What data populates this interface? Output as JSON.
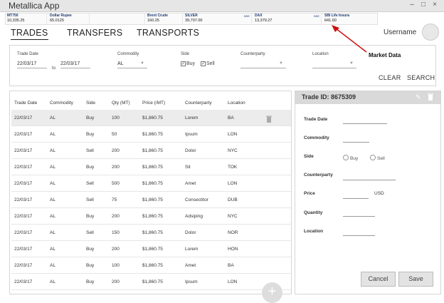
{
  "window": {
    "title": "Metallica App",
    "controls": [
      "–",
      "□",
      "×"
    ]
  },
  "ticker": [
    {
      "name": "MT750",
      "value": "10,335.25"
    },
    {
      "name": "Dollar Rupee",
      "value": "65.0125"
    },
    {
      "name": "",
      "value": ""
    },
    {
      "name": "Brent Crude",
      "value": "160.25"
    },
    {
      "name": "SILVER",
      "value": "39,707.00",
      "sub": "NSE"
    },
    {
      "name": "DAX",
      "value": "13,379.27",
      "sub": "NSE"
    },
    {
      "name": "SBI Life Insura",
      "value": "641.60",
      "sub": "NSE"
    }
  ],
  "tabs": [
    "TRADES",
    "TRANSFERS",
    "TRANSPORTS"
  ],
  "user": {
    "name": "Username"
  },
  "filters": {
    "trade_date_label": "Trade Date",
    "date_from": "22/03/17",
    "to_label": "to",
    "date_to": "22/03/17",
    "commodity_label": "Commodity",
    "commodity_value": "AL",
    "side_label": "Side",
    "buy_label": "Buy",
    "sell_label": "Sell",
    "counterparty_label": "Counterparty",
    "location_label": "Location",
    "clear_label": "CLEAR",
    "search_label": "SEARCH"
  },
  "table": {
    "columns": [
      "Trade Date",
      "Commodity",
      "Side",
      "Qty (MT)",
      "Price (/MT)",
      "Counterparty",
      "Location"
    ],
    "rows": [
      [
        "22/03/17",
        "AL",
        "Buy",
        "100",
        "$1,860.75",
        "Lorem",
        "BA"
      ],
      [
        "22/03/17",
        "AL",
        "Buy",
        "50",
        "$1,860.75",
        "Ipsum",
        "LON"
      ],
      [
        "22/03/17",
        "AL",
        "Sell",
        "200",
        "$1,860.75",
        "Dolor",
        "NYC"
      ],
      [
        "22/03/17",
        "AL",
        "Buy",
        "200",
        "$1,860.75",
        "Sit",
        "TOK"
      ],
      [
        "22/03/17",
        "AL",
        "Sell",
        "500",
        "$1,860.75",
        "Amet",
        "LON"
      ],
      [
        "22/03/17",
        "AL",
        "Sell",
        "75",
        "$1,860.75",
        "Consectitor",
        "DUB"
      ],
      [
        "22/03/17",
        "AL",
        "Buy",
        "200",
        "$1,860.75",
        "Adsiping",
        "NYC"
      ],
      [
        "22/03/17",
        "AL",
        "Sell",
        "150",
        "$1,860.75",
        "Dolor",
        "NOR"
      ],
      [
        "22/03/17",
        "AL",
        "Buy",
        "200",
        "$1,860.75",
        "Lorem",
        "HON"
      ],
      [
        "22/03/17",
        "AL",
        "Buy",
        "100",
        "$1,860.75",
        "Amet",
        "BA"
      ],
      [
        "22/03/17",
        "AL",
        "Buy",
        "200",
        "$1,860.75",
        "Ipsum",
        "LON"
      ]
    ],
    "add_button": "+"
  },
  "detail": {
    "title": "Trade ID: 8675309",
    "labels": {
      "trade_date": "Trade Date",
      "commodity": "Commodity",
      "side": "Side",
      "counterparty": "Counterparty",
      "price": "Price",
      "quantity": "Quantity",
      "location": "Location"
    },
    "buy_label": "Buy",
    "sell_label": "Sell",
    "price_unit": "USD",
    "cancel_label": "Cancel",
    "save_label": "Save"
  },
  "annotation": {
    "label": "Market Data",
    "color": "#cc1111"
  }
}
